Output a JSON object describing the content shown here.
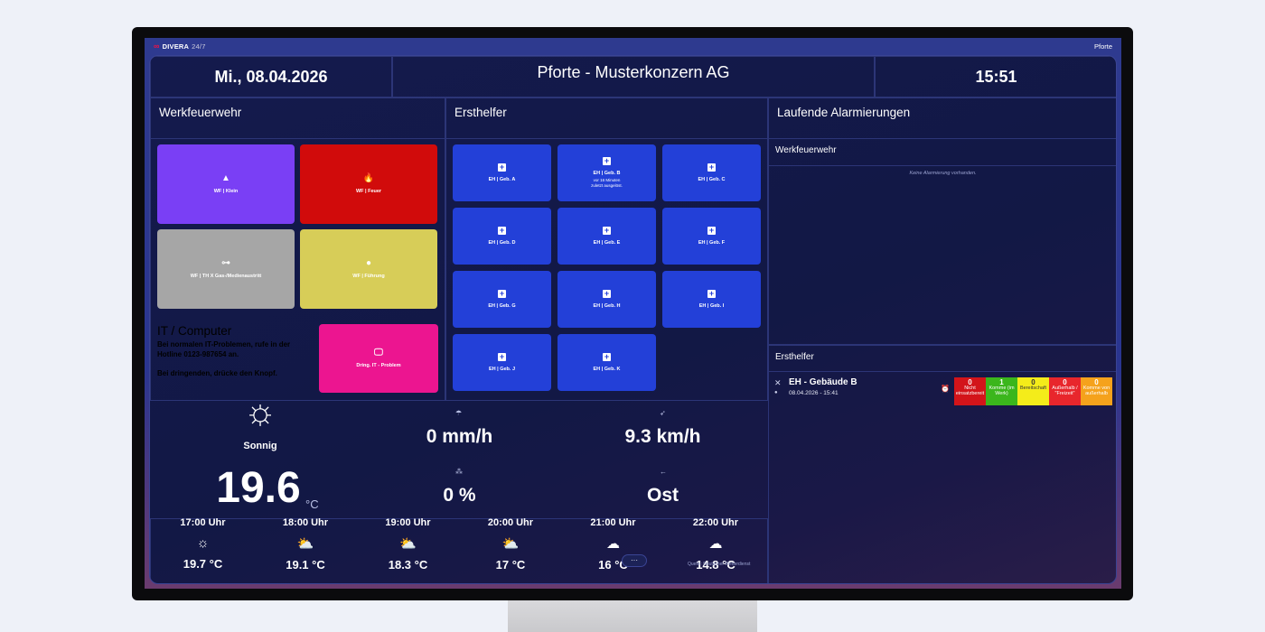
{
  "app": {
    "logo_text": "DIVERA",
    "logo_suffix": "24/7",
    "user": "Pforte"
  },
  "header": {
    "date": "Mi., 08.04.2026",
    "title": "Pforte - Musterkonzern AG",
    "time": "15:51"
  },
  "werkfeuerwehr": {
    "title": "Werkfeuerwehr",
    "tiles": [
      {
        "label": "WF | Klein",
        "icon": "warning-icon",
        "glyph": "▲",
        "color": "#7a3ff5"
      },
      {
        "label": "WF | Feuer",
        "icon": "fire-icon",
        "glyph": "🔥",
        "color": "#d10b0b"
      },
      {
        "label": "WF | TH X Gas-/Medienaustritt",
        "icon": "pipe-icon",
        "glyph": "⊶",
        "color": "#a6a6a6"
      },
      {
        "label": "WF | Führung",
        "icon": "person-icon",
        "glyph": "●",
        "color": "#d7cd58"
      }
    ]
  },
  "it": {
    "title": "IT / Computer",
    "text1": "Bei normalen IT-Problemen, rufe in der Hotline 0123-987654 an.",
    "text2": "Bei dringenden, drücke den Knopf.",
    "button_label": "Dring. IT - Problem",
    "button_color": "#ec1590"
  },
  "ersthelfer": {
    "title": "Ersthelfer",
    "tiles": [
      {
        "label": "EH | Geb. A",
        "sub": ""
      },
      {
        "label": "EH | Geb. B",
        "sub": "vor 16 Minuten\nzuletzt ausgelöst."
      },
      {
        "label": "EH | Geb. C",
        "sub": ""
      },
      {
        "label": "EH | Geb. D",
        "sub": ""
      },
      {
        "label": "EH | Geb. E",
        "sub": ""
      },
      {
        "label": "EH | Geb. F",
        "sub": ""
      },
      {
        "label": "EH | Geb. G",
        "sub": ""
      },
      {
        "label": "EH | Geb. H",
        "sub": ""
      },
      {
        "label": "EH | Geb. I",
        "sub": ""
      },
      {
        "label": "EH | Geb. J",
        "sub": ""
      },
      {
        "label": "EH | Geb. K",
        "sub": ""
      }
    ]
  },
  "weather": {
    "condition": "Sonnig",
    "temperature": "19.6",
    "unit": "°C",
    "rain": "0 mm/h",
    "wind": "9.3 km/h",
    "humidity": "0 %",
    "direction": "Ost",
    "source_note": "Quelle: Deutscher Wetterdienst",
    "forecast": [
      {
        "time": "17:00 Uhr",
        "icon": "sun-icon",
        "glyph": "☼",
        "temp": "19.7 °C"
      },
      {
        "time": "18:00 Uhr",
        "icon": "sun-cloud-icon",
        "glyph": "⛅",
        "temp": "19.1 °C"
      },
      {
        "time": "19:00 Uhr",
        "icon": "sun-cloud-icon",
        "glyph": "⛅",
        "temp": "18.3 °C"
      },
      {
        "time": "20:00 Uhr",
        "icon": "sun-cloud-icon",
        "glyph": "⛅",
        "temp": "17 °C"
      },
      {
        "time": "21:00 Uhr",
        "icon": "moon-cloud-icon",
        "glyph": "☁",
        "temp": "16 °C"
      },
      {
        "time": "22:00 Uhr",
        "icon": "moon-cloud-icon",
        "glyph": "☁",
        "temp": "14.8 °C"
      }
    ],
    "more_label": "···"
  },
  "alarms": {
    "title": "Laufende Alarmierungen",
    "wf_title": "Werkfeuerwehr",
    "wf_empty": "Keine Alarmierung vorhanden.",
    "eh_title": "Ersthelfer",
    "entry": {
      "title": "EH - Gebäude B",
      "datetime": "08.04.2026 - 15:41",
      "statuses": [
        {
          "count": "0",
          "label": "Nicht einsatzbereit",
          "color": "#d3141a"
        },
        {
          "count": "1",
          "label": "Komme (im Werk)",
          "color": "#3bb61c"
        },
        {
          "count": "0",
          "label": "Bereitschaft",
          "color": "#f4ec1a"
        },
        {
          "count": "0",
          "label": "Außerhalb / \"Freizeit\"",
          "color": "#e8262c"
        },
        {
          "count": "0",
          "label": "Komme von außerhalb",
          "color": "#f5a21c"
        }
      ]
    }
  }
}
